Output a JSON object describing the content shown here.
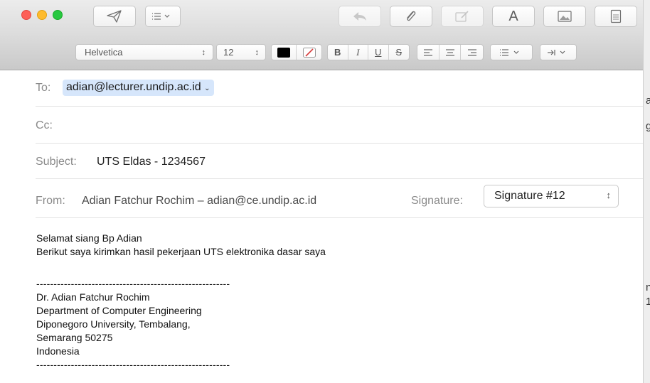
{
  "toolbar": {
    "send_icon": "paper-plane-icon",
    "header_fields_icon": "list-options-icon",
    "reply_icon": "reply-arrow-icon",
    "attach_icon": "paperclip-icon",
    "markup_icon": "markup-icon",
    "fonts_label": "A",
    "photo_icon": "photo-browser-icon",
    "stationery_icon": "stationery-icon"
  },
  "format": {
    "font_family": "Helvetica",
    "font_size": "12",
    "text_color": "#000000",
    "bold": "B",
    "italic": "I",
    "underline": "U",
    "strike": "S"
  },
  "headers": {
    "to_label": "To:",
    "to_value": "adian@lecturer.undip.ac.id",
    "cc_label": "Cc:",
    "subject_label": "Subject:",
    "subject_value": "UTS Eldas - 1234567",
    "from_label": "From:",
    "from_value": "Adian Fatchur Rochim – adian@ce.undip.ac.id",
    "signature_label": "Signature:",
    "signature_value": "Signature #12"
  },
  "message": {
    "line1": "Selamat siang Bp Adian",
    "line2": "Berikut saya kirimkan hasil pekerjaan UTS elektronika dasar saya",
    "separator": "--------------------------------------------------------",
    "sig_name": "Dr. Adian Fatchur Rochim",
    "sig_dept": "Department of Computer Engineering",
    "sig_univ": "Diponegoro University, Tembalang,",
    "sig_city": "Semarang 50275",
    "sig_country": "Indonesia",
    "separator_end": "--------------------------------------------------------"
  },
  "edge_chars": [
    "a",
    "g",
    "n",
    "1"
  ],
  "colors": {
    "close": "#fd5f57",
    "minimize": "#febb2e",
    "zoom": "#28c840",
    "token": "#d6e6fb"
  }
}
